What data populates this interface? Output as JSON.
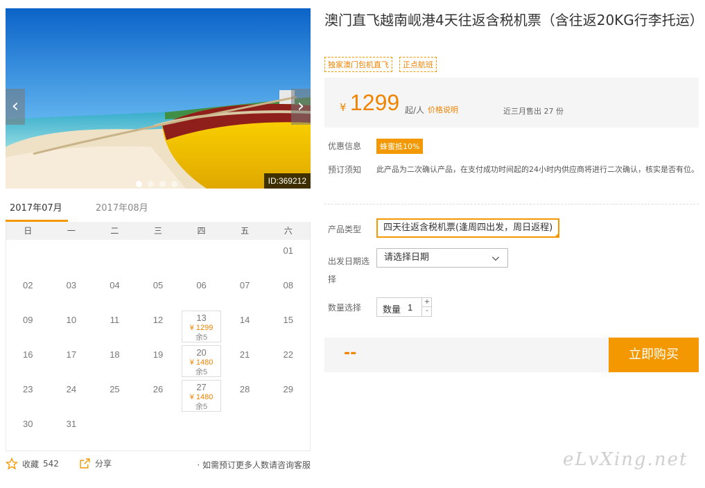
{
  "gallery": {
    "id_label": "ID:369212",
    "prev_arrow": "‹",
    "next_arrow": "›",
    "dot_count": 4,
    "active_dot": 0
  },
  "calendar": {
    "months": [
      "2017年07月",
      "2017年08月"
    ],
    "active_month": 0,
    "weekdays": [
      "日",
      "一",
      "二",
      "三",
      "四",
      "五",
      "六"
    ],
    "leading_blanks": 6,
    "days": [
      {
        "day": "01"
      },
      {
        "day": "02"
      },
      {
        "day": "03"
      },
      {
        "day": "04"
      },
      {
        "day": "05"
      },
      {
        "day": "06"
      },
      {
        "day": "07"
      },
      {
        "day": "08"
      },
      {
        "day": "09"
      },
      {
        "day": "10"
      },
      {
        "day": "11"
      },
      {
        "day": "12"
      },
      {
        "day": "13",
        "price": "¥ 1299",
        "stock": "余5"
      },
      {
        "day": "14"
      },
      {
        "day": "15"
      },
      {
        "day": "16"
      },
      {
        "day": "17"
      },
      {
        "day": "18"
      },
      {
        "day": "19"
      },
      {
        "day": "20",
        "price": "¥ 1480",
        "stock": "余5"
      },
      {
        "day": "21"
      },
      {
        "day": "22"
      },
      {
        "day": "23"
      },
      {
        "day": "24"
      },
      {
        "day": "25"
      },
      {
        "day": "26"
      },
      {
        "day": "27",
        "price": "¥ 1480",
        "stock": "余5"
      },
      {
        "day": "28"
      },
      {
        "day": "29"
      },
      {
        "day": "30"
      },
      {
        "day": "31"
      }
    ]
  },
  "bottom": {
    "favorite_label": "收藏",
    "favorite_count": "542",
    "share_label": "分享",
    "advice": "· 如需预订更多人数请咨询客服"
  },
  "product": {
    "title": "澳门直飞越南岘港4天往返含税机票（含往返20KG行李托运）",
    "tags": [
      "独家澳门包机直飞",
      "正点航班"
    ],
    "currency": "¥",
    "price": "1299",
    "per_person": "起/人",
    "price_explain": "价格说明",
    "sold": "近三月售出 27 份"
  },
  "info": {
    "promo_label": "优惠信息",
    "promo_badge": "蜂蜜抵10%",
    "notice_label": "预订须知",
    "notice_text": "此产品为二次确认产品，在支付成功时间起的24小时内供应商将进行二次确认，核实是否有位。"
  },
  "options": {
    "type_label": "产品类型",
    "type_value": "四天往返含税机票(逢周四出发，周日返程)",
    "date_label": "出发日期选择",
    "date_placeholder": "请选择日期",
    "qty_label": "数量选择",
    "qty_inner_label": "数量",
    "qty_value": "1",
    "plus": "+",
    "minus": "-"
  },
  "purchase": {
    "total": "--",
    "buy_label": "立即购买"
  },
  "watermark": "eLvXing.net",
  "colors": {
    "accent": "#f39800",
    "price": "#f08300"
  }
}
